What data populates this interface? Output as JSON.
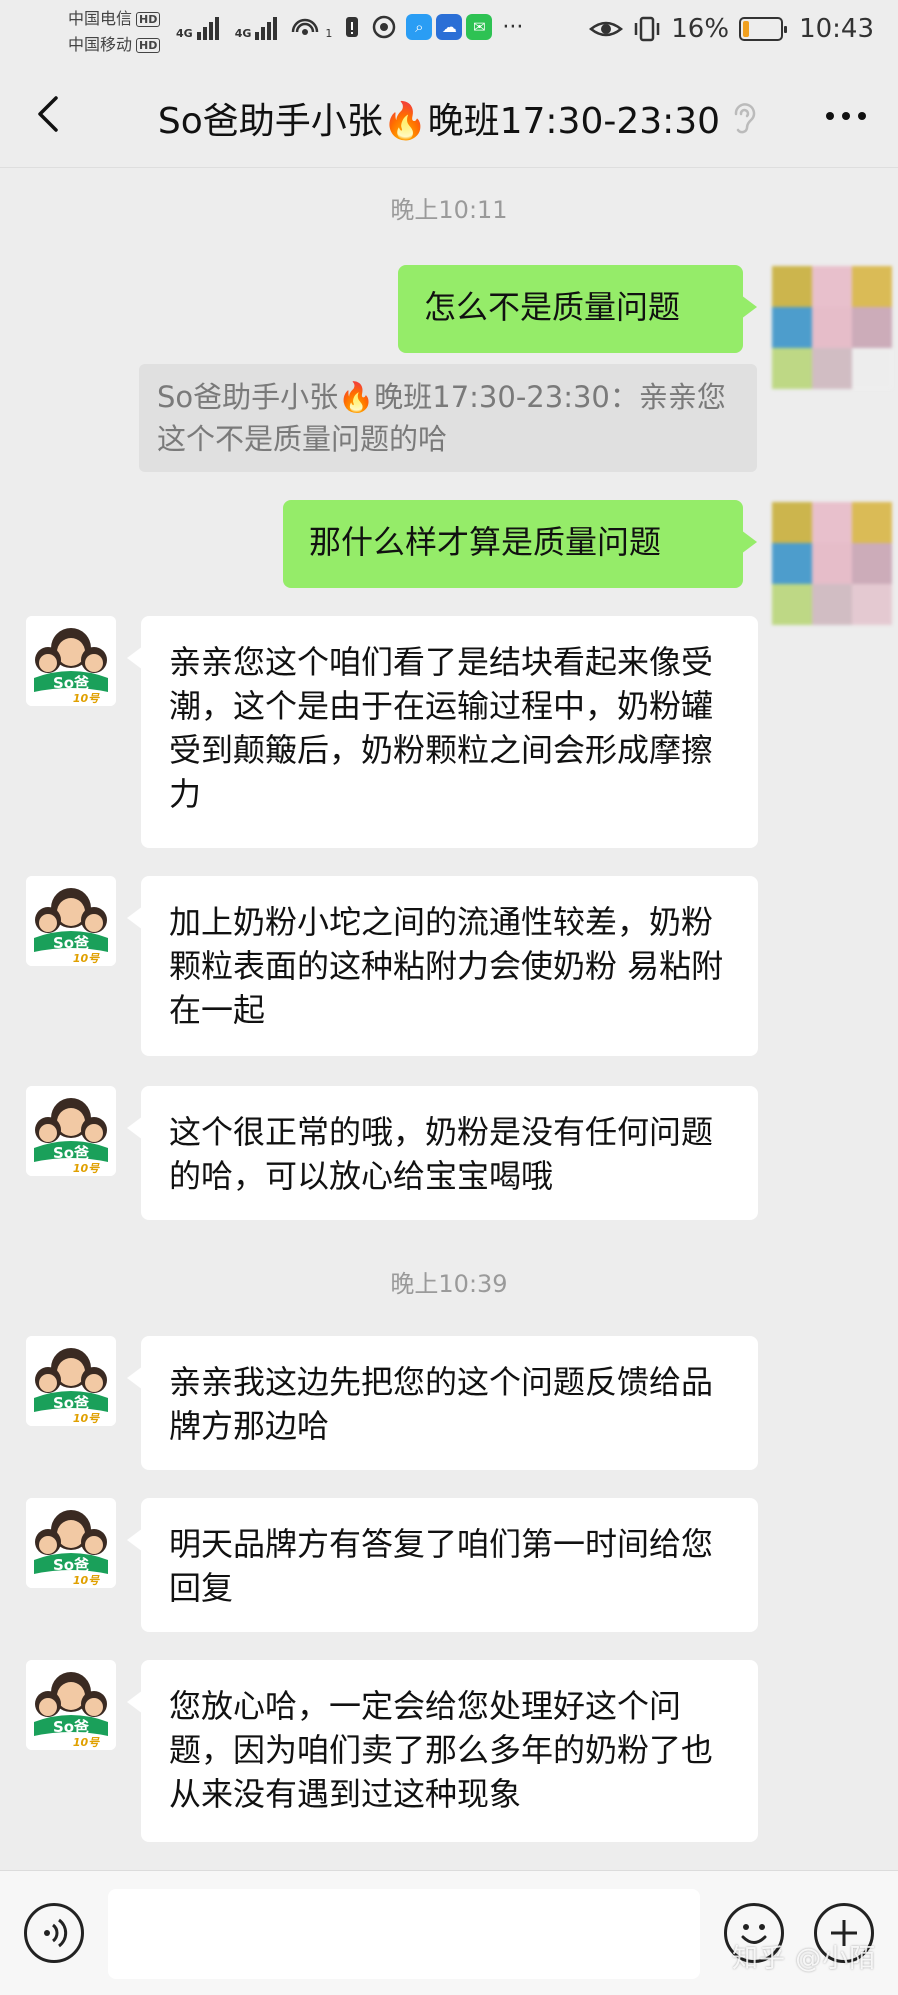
{
  "status_bar": {
    "carrier1": "中国电信",
    "carrier2": "中国移动",
    "hd": "HD",
    "net1": "4G",
    "net2": "4G",
    "wifi_sup": "1",
    "dots": "···",
    "battery_text": "16%",
    "battery_level": 0.16,
    "time": "10:43"
  },
  "header": {
    "title": "So爸助手小张🔥晚班17:30-23:30"
  },
  "timestamps": [
    "晚上10:11",
    "晚上10:39"
  ],
  "messages": {
    "out1": "怎么不是质量问题",
    "quote": "So爸助手小张🔥晚班17:30-23:30：亲亲您这个不是质量问题的哈",
    "out2": "那什么样才算是质量问题",
    "in1": "亲亲您这个咱们看了是结块看起来像受潮，这个是由于在运输过程中，奶粉罐受到颠簸后，奶粉颗粒之间会形成摩擦力",
    "in2": "加上奶粉小坨之间的流通性较差，奶粉颗粒表面的这种粘附力会使奶粉 易粘附在一起",
    "in3": "这个很正常的哦，奶粉是没有任何问题的哈，可以放心给宝宝喝哦",
    "in4": "亲亲我这边先把您的这个问题反馈给品牌方那边哈",
    "in5": "明天品牌方有答复了咱们第一时间给您回复",
    "in6": "您放心哈，一定会给您处理好这个问题，因为咱们卖了那么多年的奶粉了也从来没有遇到过这种现象"
  },
  "avatar": {
    "logo_text": "So爸",
    "sub_text": "10号"
  },
  "input_bar": {
    "message_value": ""
  },
  "watermark": "知乎 @小陌",
  "colors": {
    "background": "#ededed",
    "outgoing_bubble": "#95ec69",
    "incoming_bubble": "#ffffff",
    "quote_bg": "#e0e0e0"
  }
}
